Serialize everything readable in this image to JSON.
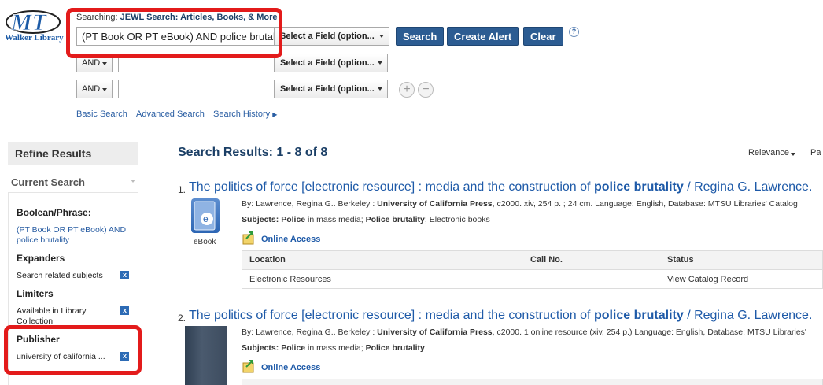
{
  "logo": {
    "initials": "MT",
    "name": "Walker Library"
  },
  "search": {
    "searching_label": "Searching:",
    "searching_target": "JEWL Search: Articles, Books, & More",
    "row1_value": "(PT Book OR PT eBook) AND police brutality",
    "row1_field": "Select a Field (option...",
    "row2_bool": "AND",
    "row2_field": "Select a Field (option...",
    "row3_bool": "AND",
    "row3_field": "Select a Field (option...",
    "buttons": {
      "search": "Search",
      "create_alert": "Create Alert",
      "clear": "Clear"
    },
    "help": "?",
    "add_row": "+",
    "remove_row": "−",
    "links": {
      "basic": "Basic Search",
      "advanced": "Advanced Search",
      "history": "Search History"
    }
  },
  "sidebar": {
    "refine_title": "Refine Results",
    "current_search": "Current Search",
    "boolean_heading": "Boolean/Phrase:",
    "boolean_value": "(PT Book OR PT eBook) AND police brutality",
    "expanders_heading": "Expanders",
    "expander_item": "Search related subjects",
    "limiters_heading": "Limiters",
    "limiter_item": "Available in Library Collection",
    "publisher_heading": "Publisher",
    "publisher_item": "university of california ...",
    "remove_icon": "x"
  },
  "results": {
    "title": "Search Results: 1 - 8 of 8",
    "sort": "Relevance",
    "page_options": "Pa",
    "items": [
      {
        "number": "1.",
        "title_pre": "The politics of force [electronic resource] : media and the construction of",
        "title_bold": "police brutality",
        "title_post": "/ Regina G. Lawrence.",
        "byline_pre": "By: Lawrence, Regina G.. Berkeley :",
        "publisher": "University of California Press",
        "byline_post": ", c2000. xiv, 254 p. ; 24 cm. Language: English, Database: MTSU Libraries' Catalog",
        "subjects_label": "Subjects:",
        "subj1_bold": "Police",
        "subj1_rest": "in mass media;",
        "subj2_bold": "Police brutality",
        "subj3": "; Electronic books",
        "format": "eBook",
        "online": "Online Access",
        "table": {
          "headers": [
            "Location",
            "Call No.",
            "Status"
          ],
          "row": [
            "Electronic Resources",
            "",
            "View Catalog Record"
          ]
        }
      },
      {
        "number": "2.",
        "title_pre": "The politics of force [electronic resource] : media and the construction of",
        "title_bold": "police brutality",
        "title_post": "/ Regina G. Lawrence.",
        "byline_pre": "By: Lawrence, Regina G.. Berkeley :",
        "publisher": "University of California Press",
        "byline_post": ", c2000. 1 online resource (xiv, 254 p.) Language: English, Database: MTSU Libraries'",
        "subjects_label": "Subjects:",
        "subj1_bold": "Police",
        "subj1_rest": "in mass media;",
        "subj2_bold": "Police brutality",
        "online": "Online Access"
      }
    ]
  },
  "colors": {
    "highlight_red": "#e31b1b",
    "button_blue": "#2c5c92",
    "link_blue": "#1e5aa8"
  }
}
